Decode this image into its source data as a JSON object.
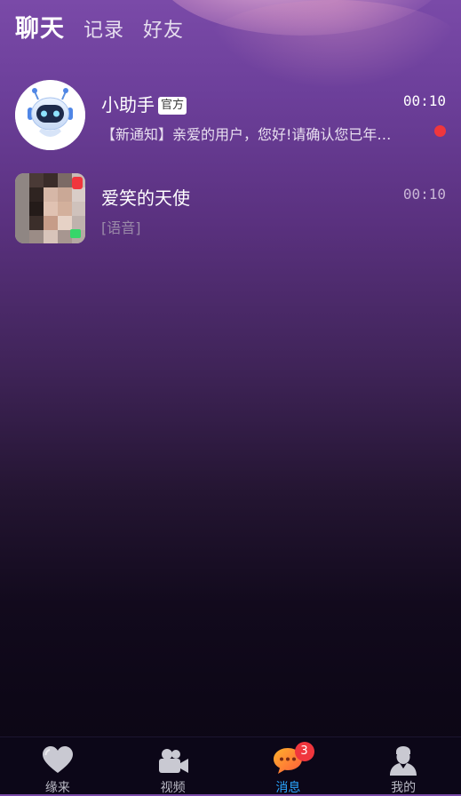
{
  "theme": {
    "accent": "#2aa6ff",
    "unread_dot": "#f0363d",
    "badge_bg": "#f0363d",
    "time_color": "#ffffff",
    "time_color_dim": "#c9b6d6",
    "preview_color": "#e8dff0",
    "preview_color_dim": "#9a8aa8"
  },
  "header": {
    "tabs": [
      {
        "label": "聊天",
        "active": true
      },
      {
        "label": "记录",
        "active": false
      },
      {
        "label": "好友",
        "active": false
      }
    ]
  },
  "conversations": [
    {
      "name": "小助手",
      "badge": "官方",
      "time": "00:10",
      "preview": "【新通知】亲爱的用户，您好!请确认您已年…",
      "unread": true,
      "avatar_icon": "robot-icon"
    },
    {
      "name": "爱笑的天使",
      "time": "00:10",
      "preview": "[语音]",
      "unread": false,
      "avatar_icon": "user-photo-avatar"
    }
  ],
  "bottom_nav": {
    "items": [
      {
        "label": "缘来",
        "icon": "heart-icon"
      },
      {
        "label": "视频",
        "icon": "video-camera-icon"
      },
      {
        "label": "消息",
        "icon": "chat-bubble-icon",
        "badge": "3",
        "active": true
      },
      {
        "label": "我的",
        "icon": "profile-icon"
      }
    ]
  }
}
